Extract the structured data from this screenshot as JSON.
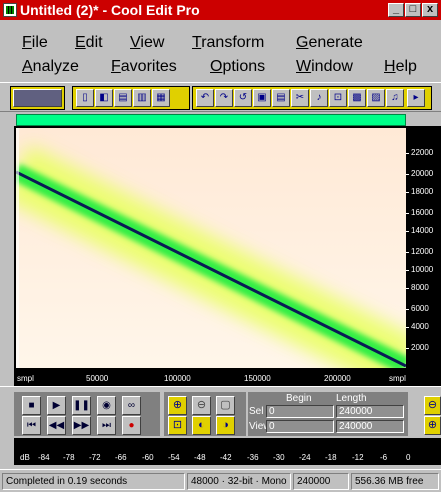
{
  "window": {
    "title": "Untitled (2)* - Cool Edit Pro",
    "minimize": "_",
    "maximize": "□",
    "close": "x"
  },
  "menu": {
    "row1": [
      "File",
      "Edit",
      "View",
      "Transform",
      "Generate"
    ],
    "row2": [
      "Analyze",
      "Favorites",
      "Options",
      "Window",
      "Help"
    ]
  },
  "spectral": {
    "y_ticks": [
      "22000",
      "20000",
      "18000",
      "16000",
      "14000",
      "12000",
      "10000",
      "8000",
      "6000",
      "4000",
      "2000"
    ],
    "x_ticks": [
      "smpl",
      "50000",
      "100000",
      "150000",
      "200000",
      "smpl"
    ],
    "colors": {
      "background": "#fff2e0",
      "glow": "#33ee44",
      "line": "#0a1a55"
    }
  },
  "transport": {
    "begin_label": "Begin",
    "length_label": "Length",
    "sel_label": "Sel",
    "view_label": "View",
    "sel_begin": "0",
    "sel_length": "240000",
    "view_begin": "0",
    "view_length": "240000"
  },
  "meter": {
    "ticks": [
      "dB",
      "-84",
      "-78",
      "-72",
      "-66",
      "-60",
      "-54",
      "-48",
      "-42",
      "-36",
      "-30",
      "-24",
      "-18",
      "-12",
      "-6",
      "0"
    ]
  },
  "status": {
    "message": "Completed in 0.19 seconds",
    "format": "48000 · 32-bit · Mono",
    "samples": "240000",
    "free": "556.36 MB free"
  }
}
